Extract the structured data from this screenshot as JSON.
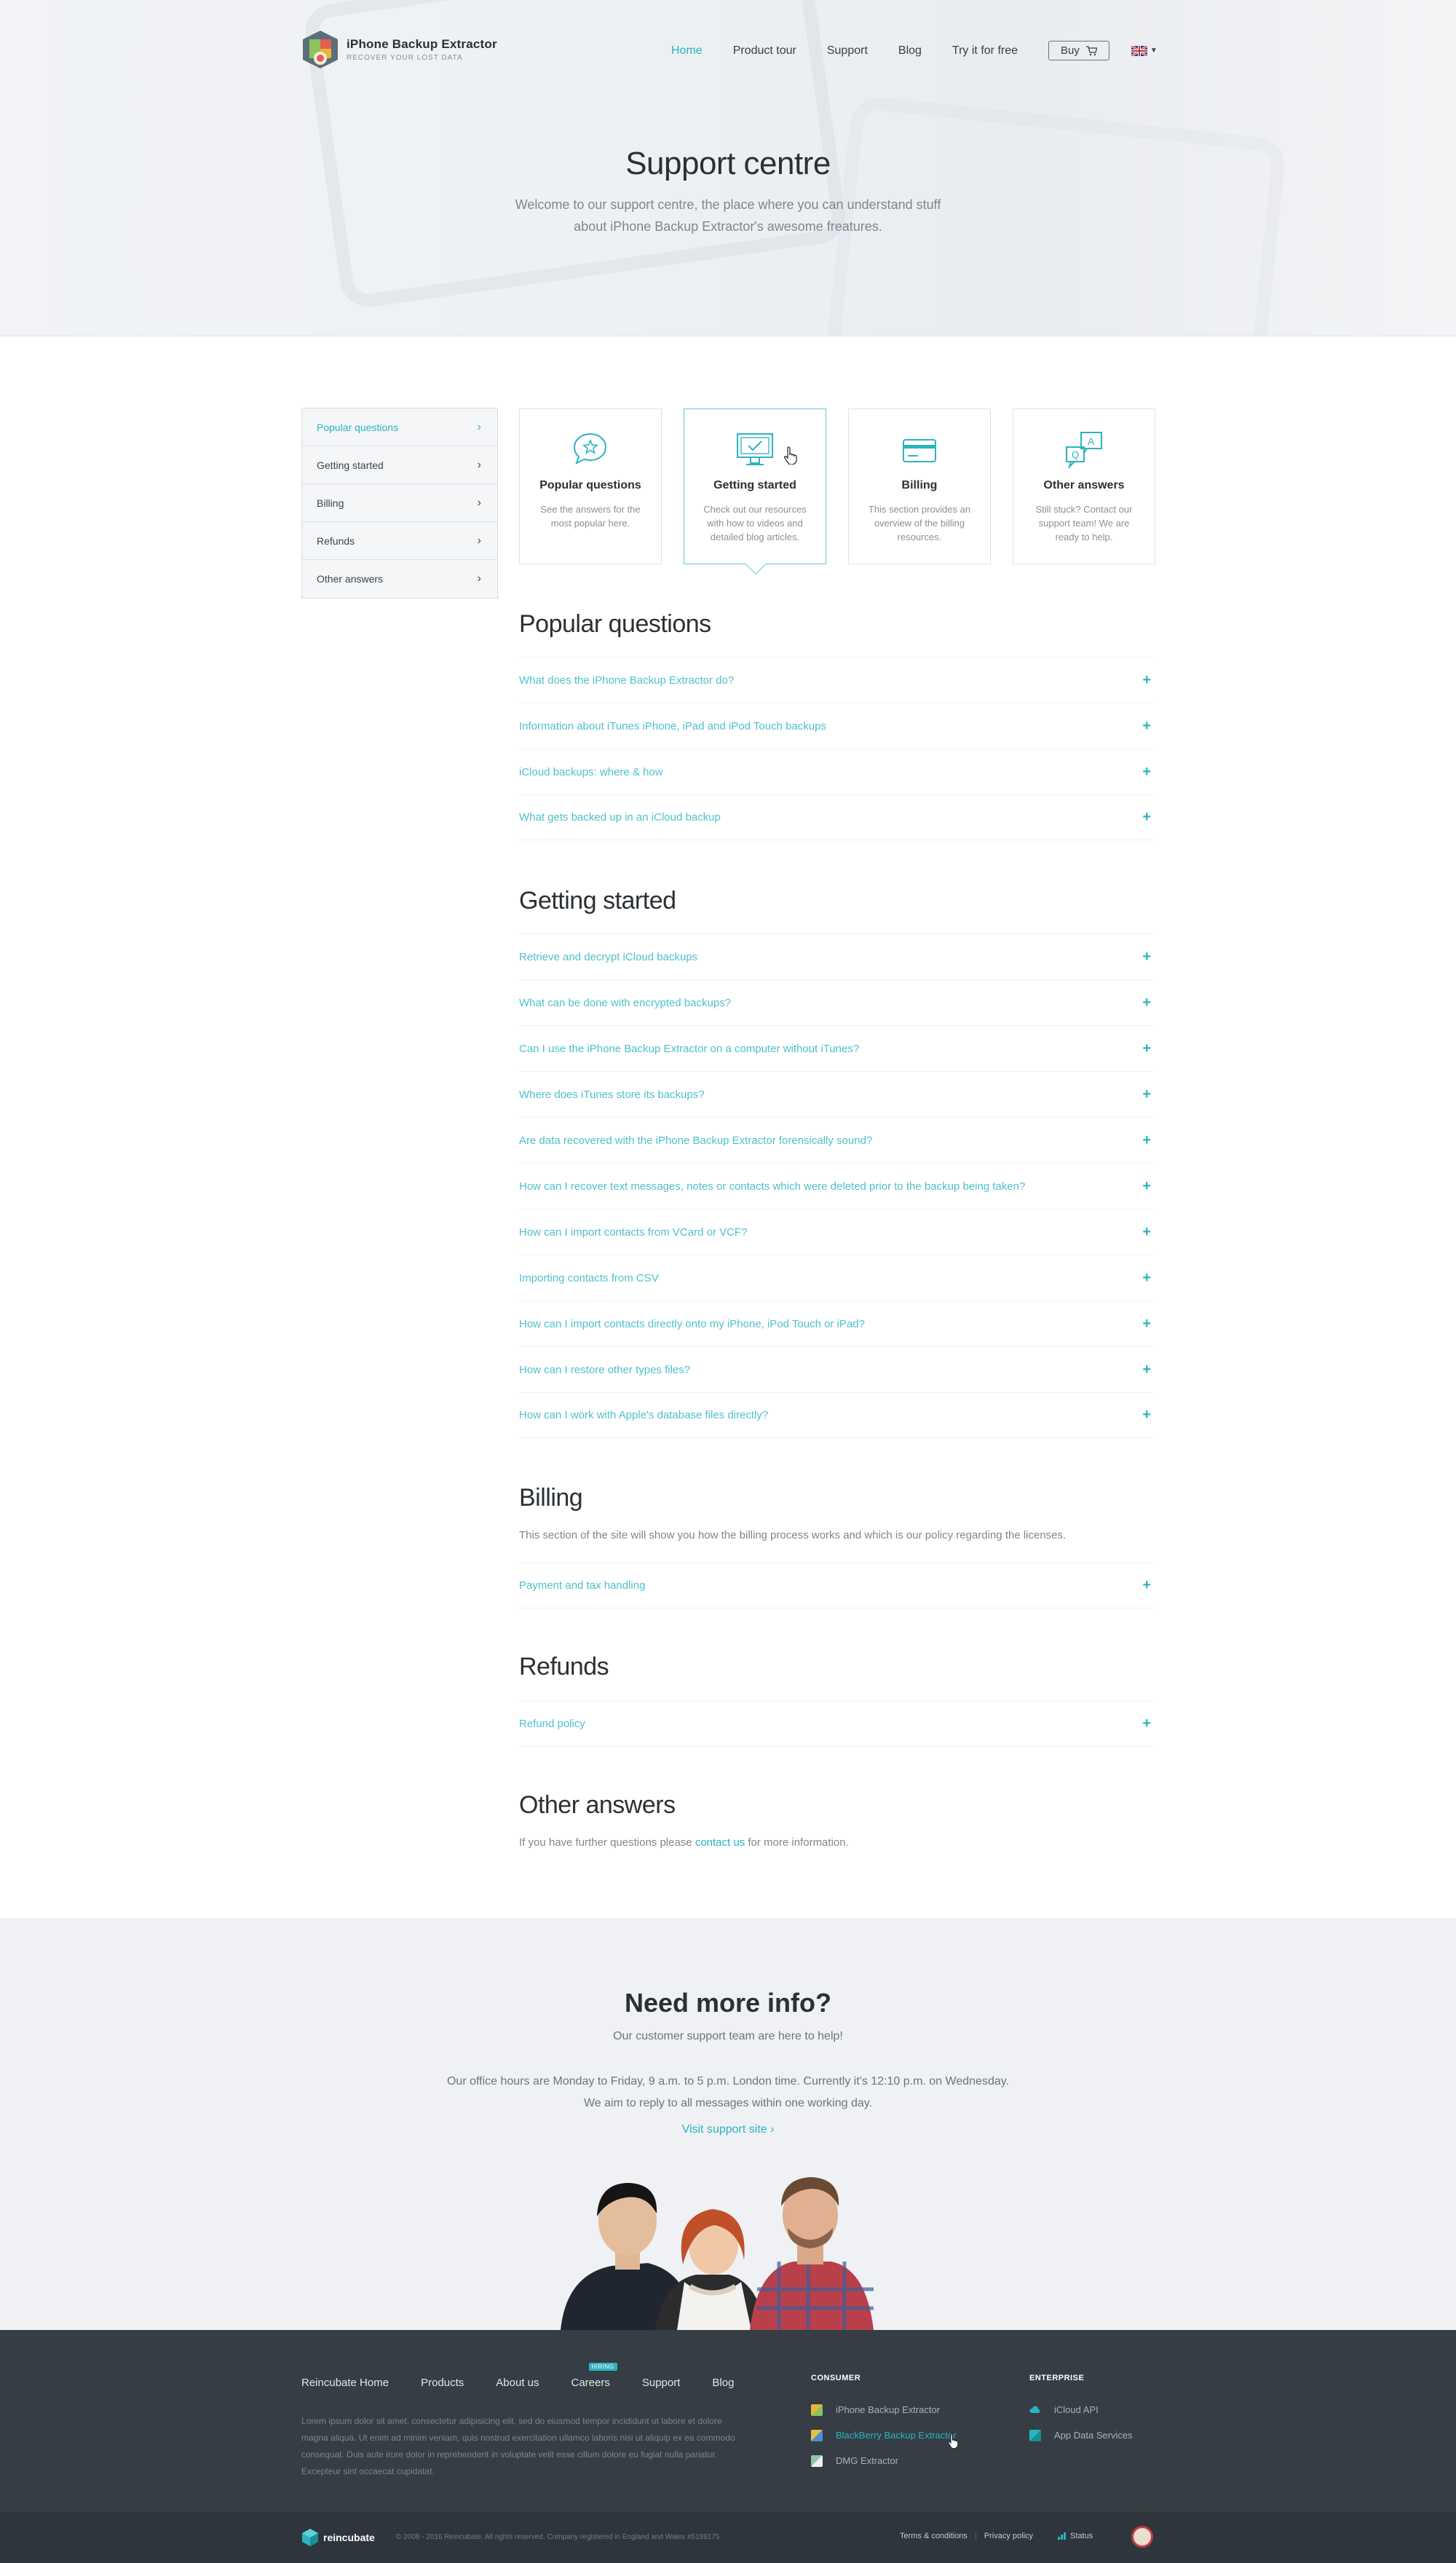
{
  "header": {
    "logo_title": "iPhone Backup Extractor",
    "logo_subtitle": "RECOVER YOUR LOST DATA",
    "nav": [
      {
        "label": "Home",
        "active": true
      },
      {
        "label": "Product tour"
      },
      {
        "label": "Support"
      },
      {
        "label": "Blog"
      },
      {
        "label": "Try it for free"
      }
    ],
    "buy_label": "Buy",
    "language_icon": "uk-flag-icon"
  },
  "hero": {
    "title": "Support centre",
    "subtitle": "Welcome to our support centre, the place where you can understand stuff about iPhone Backup Extractor's awesome freatures."
  },
  "sidebar": {
    "items": [
      {
        "label": "Popular questions",
        "active": true
      },
      {
        "label": "Getting started"
      },
      {
        "label": "Billing"
      },
      {
        "label": "Refunds"
      },
      {
        "label": "Other answers"
      }
    ]
  },
  "cards": [
    {
      "title": "Popular questions",
      "desc": "See the answers for the most popular here.",
      "icon": "star-chat-icon"
    },
    {
      "title": "Getting started",
      "desc": "Check out our resources with how to videos and detailed blog articles.",
      "icon": "monitor-check-icon",
      "active": true
    },
    {
      "title": "Billing",
      "desc": "This section provides an overview of the billing resources.",
      "icon": "credit-card-icon"
    },
    {
      "title": "Other answers",
      "desc": "Still stuck? Contact our support team! We are ready to help.",
      "icon": "qa-chat-icon"
    }
  ],
  "sections": {
    "popular": {
      "title": "Popular questions",
      "items": [
        "What does the iPhone Backup Extractor do?",
        "Information about iTunes iPhone, iPad and iPod Touch backups",
        "iCloud backups: where & how",
        "What gets backed up in an iCloud backup"
      ]
    },
    "getting_started": {
      "title": "Getting started",
      "items": [
        "Retrieve and decrypt iCloud backups",
        "What can be done with encrypted backups?",
        "Can I use the iPhone Backup Extractor on a computer without iTunes?",
        "Where does iTunes store its backups?",
        "Are data recovered with the iPhone Backup Extractor forensically sound?",
        "How can I recover text messages, notes or contacts which were deleted prior to the backup being taken?",
        "How can I import contacts from VCard or VCF?",
        "Importing contacts from CSV",
        "How can I import contacts directly onto my iPhone, iPod Touch or iPad?",
        "How can I restore other types files?",
        "How can I work with Apple's database files directly?"
      ]
    },
    "billing": {
      "title": "Billing",
      "text": "This section of the site will show you how the billing process works and which is our policy regarding the licenses.",
      "items": [
        "Payment and tax handling"
      ]
    },
    "refunds": {
      "title": "Refunds",
      "items": [
        "Refund policy"
      ]
    },
    "other": {
      "title": "Other answers",
      "text_before": "If you have further questions please ",
      "link": "contact us",
      "text_after": " for more information."
    }
  },
  "info": {
    "title": "Need more info?",
    "subtitle": "Our customer support team are here to help!",
    "hours_line1": "Our office hours are Monday to Friday, 9 a.m. to 5 p.m. London time. Currently it's 12:10 p.m. on Wednesday.",
    "hours_line2": "We aim to reply to all messages within one working day.",
    "link": "Visit support site"
  },
  "footer": {
    "nav": [
      {
        "label": "Reincubate Home"
      },
      {
        "label": "Products"
      },
      {
        "label": "About us"
      },
      {
        "label": "Careers",
        "badge": "HIRING"
      },
      {
        "label": "Support"
      },
      {
        "label": "Blog"
      }
    ],
    "lorem": "Lorem ipsum dolor sit amet, consectetur adipisicing elit, sed do eiusmod tempor incididunt ut labore et dolore magna aliqua. Ut enim ad minim veniam, quis nostrud exercitation ullamco laboris nisi ut aliquip ex ea commodo consequat. Duis aute irure dolor in reprehenderit in voluptate velit esse cillum dolore eu fugiat nulla pariatur. Excepteur sint occaecat cupidatat.",
    "consumer_title": "CONSUMER",
    "consumer": [
      {
        "label": "iPhone Backup Extractor",
        "color": "#e3b53a"
      },
      {
        "label": "BlackBerry Backup Extractor",
        "color": "#e2c14a",
        "highlight": true
      },
      {
        "label": "DMG Extractor",
        "color": "#8fc7a8"
      }
    ],
    "enterprise_title": "ENTERPRISE",
    "enterprise": [
      {
        "label": "iCloud API",
        "color": "#2bb3c0"
      },
      {
        "label": "App Data Services",
        "color": "#2bb3c0"
      }
    ],
    "brand": "reincubate",
    "copyright": "© 2008 - 2016 Reincubate. All rights reserved. Company registered in England and Wales #5189175.",
    "terms": "Terms & conditions",
    "privacy": "Privacy policy",
    "status": "Status"
  }
}
